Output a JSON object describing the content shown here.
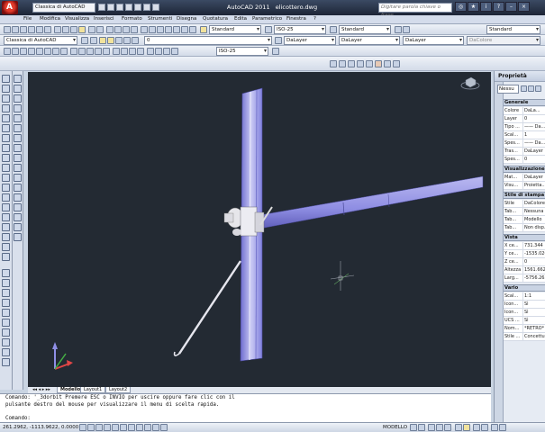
{
  "titlebar": {
    "workspace": "Classica di AutoCAD",
    "app_name": "AutoCAD 2011",
    "file_name": "elicottero.dwg",
    "search_placeholder": "Digitare parola chiave o frase"
  },
  "menu": [
    "File",
    "Modifica",
    "Visualizza",
    "Inserisci",
    "Formato",
    "Strumenti",
    "Disegna",
    "Quotatura",
    "Edita",
    "Parametrico",
    "Finestra",
    "?"
  ],
  "toolbar1": {
    "text_style": "Standard",
    "dim_style": "ISO-25",
    "table_style": "Standard",
    "mleader_style": "Standard"
  },
  "toolbar2": {
    "workspace_combo": "Classica di AutoCAD",
    "layer_value": "0",
    "color": "DaLayer",
    "linetype": "DaLayer",
    "lineweight": "DaLayer",
    "plotstyle": "DaColore"
  },
  "toolbar3": {
    "dim_style": "ISO-25"
  },
  "layout_tabs": [
    "Modello",
    "Layout1",
    "Layout2"
  ],
  "command_lines": [
    "Comando: '_3dorbit Premere ESC o INVIO per uscire oppure fare clic con il",
    "pulsante destro del mouse per visualizzare il menu di scelta rapida.",
    "",
    "Comando:"
  ],
  "status": {
    "coords": "261.2962, -1113.9622, 0.0000",
    "mode": "MODELLO"
  },
  "properties": {
    "title": "Proprietà",
    "selection": "Nessu",
    "sections": [
      {
        "name": "Generale",
        "rows": [
          {
            "k": "Colore",
            "v": "DaLa..."
          },
          {
            "k": "Layer",
            "v": "0"
          },
          {
            "k": "Tipo ...",
            "v": "—— Da..."
          },
          {
            "k": "Scal...",
            "v": "1"
          },
          {
            "k": "Spes...",
            "v": "—— Da..."
          },
          {
            "k": "Tras...",
            "v": "DaLayer"
          },
          {
            "k": "Spes...",
            "v": "0"
          }
        ]
      },
      {
        "name": "Visualizzazione...",
        "rows": [
          {
            "k": "Mat...",
            "v": "DaLayer"
          },
          {
            "k": "Visu...",
            "v": "Proietta..."
          }
        ]
      },
      {
        "name": "Stile di stampa",
        "rows": [
          {
            "k": "Stile",
            "v": "DaColore"
          },
          {
            "k": "Tab...",
            "v": "Nessuna"
          },
          {
            "k": "Tab...",
            "v": "Modello"
          },
          {
            "k": "Tab...",
            "v": "Non disp..."
          }
        ]
      },
      {
        "name": "Vista",
        "rows": [
          {
            "k": "X ce...",
            "v": "731.344"
          },
          {
            "k": "Y ce...",
            "v": "-1535.020"
          },
          {
            "k": "Z ce...",
            "v": "0"
          },
          {
            "k": "Altezza",
            "v": "1561.6627"
          },
          {
            "k": "Larg...",
            "v": "-5756.265"
          }
        ]
      },
      {
        "name": "Vario",
        "rows": [
          {
            "k": "Scal...",
            "v": "1:1"
          },
          {
            "k": "Icon...",
            "v": "Sì"
          },
          {
            "k": "Icon...",
            "v": "Sì"
          },
          {
            "k": "UCS ...",
            "v": "Sì"
          },
          {
            "k": "Nom...",
            "v": "*RETRO*"
          },
          {
            "k": "Stile ...",
            "v": "Concettu..."
          }
        ]
      }
    ]
  },
  "colors": {
    "viewport_bg": "#232a33",
    "model_blue": "#8f8ee3",
    "model_white": "#e8e8ee"
  }
}
